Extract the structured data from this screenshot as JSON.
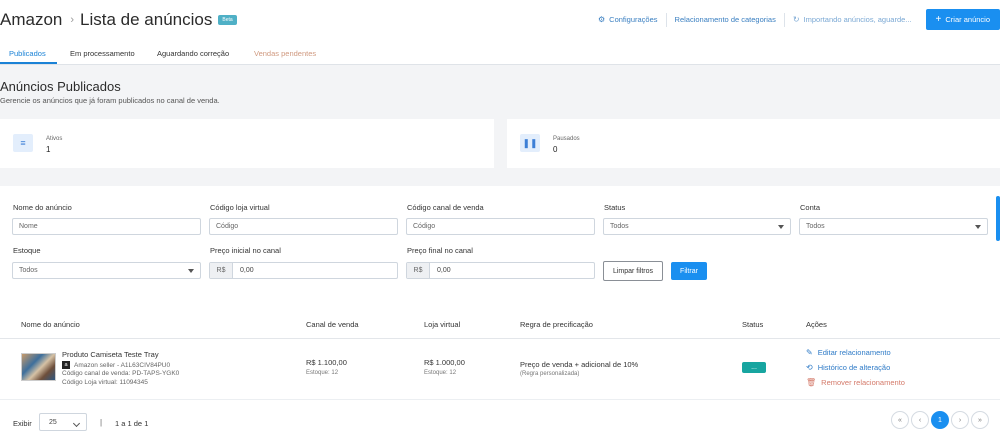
{
  "header": {
    "app_name": "Amazon",
    "breadcrumb_separator": "›",
    "page_title": "Lista de anúncios",
    "beta_badge": "Beta",
    "settings_label": "Configurações",
    "categories_label": "Relacionamento de categorias",
    "importing_label": "Importando anúncios, aguarde...",
    "create_label": "Criar anúncio"
  },
  "tabs": [
    {
      "label": "Publicados",
      "state": "active"
    },
    {
      "label": "Em processamento",
      "state": "normal"
    },
    {
      "label": "Aguardando correção",
      "state": "normal"
    },
    {
      "label": "Vendas pendentes",
      "state": "disabled"
    }
  ],
  "section": {
    "title": "Anúncios Publicados",
    "subtitle": "Gerencie os anúncios que já foram publicados no canal de venda."
  },
  "stats": [
    {
      "label": "Ativos",
      "value": "1",
      "icon": "list-icon"
    },
    {
      "label": "Pausados",
      "value": "0",
      "icon": "pause-icon"
    }
  ],
  "filters": {
    "nome": {
      "label": "Nome do anúncio",
      "placeholder": "Nome"
    },
    "codigo_loja": {
      "label": "Código loja virtual",
      "placeholder": "Código"
    },
    "codigo_canal": {
      "label": "Código canal de venda",
      "placeholder": "Código"
    },
    "status": {
      "label": "Status",
      "value": "Todos"
    },
    "conta": {
      "label": "Conta",
      "value": "Todos"
    },
    "estoque": {
      "label": "Estoque",
      "value": "Todos"
    },
    "preco_inicial": {
      "label": "Preço inicial no canal",
      "prefix": "R$",
      "value": "0,00"
    },
    "preco_final": {
      "label": "Preço final no canal",
      "prefix": "R$",
      "value": "0,00"
    },
    "clear_label": "Limpar filtros",
    "filter_label": "Filtrar"
  },
  "table": {
    "headers": [
      "Nome do anúncio",
      "Canal de venda",
      "Loja virtual",
      "Regra de precificação",
      "Status",
      "Ações"
    ],
    "rows": [
      {
        "name": "Produto Camiseta Teste Tray",
        "seller": "Amazon seller - A1L63CIV84PU0",
        "codigo_canal": "Código canal de venda: PD-TAPS-YGK0",
        "codigo_loja": "Código Loja virtual: 11094345",
        "canal_price": "R$ 1.100,00",
        "canal_stock": "Estoque: 12",
        "loja_price": "R$ 1.000,00",
        "loja_stock": "Estoque: 12",
        "rule": "Preço de venda + adicional de 10%",
        "rule_note": "(Regra personalizada)",
        "status": "...",
        "actions": [
          "Editar relacionamento",
          "Histórico de alteração",
          "Remover relacionamento"
        ]
      }
    ]
  },
  "footer": {
    "show_label": "Exibir",
    "per_page": "25",
    "pipe": "|",
    "range": "1 a 1 de 1",
    "pages": [
      "«",
      "‹",
      "1",
      "›",
      "»"
    ]
  },
  "colors": {
    "primary": "#1a8ff0",
    "status_active": "#17a5a0",
    "danger_link": "#d47a6a"
  }
}
